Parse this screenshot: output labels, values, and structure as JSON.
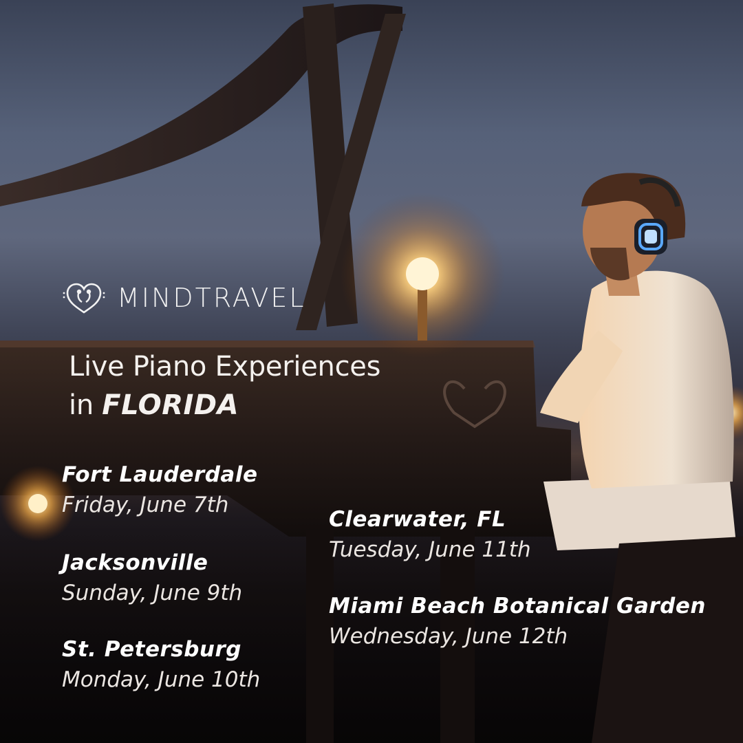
{
  "brand": {
    "name": "MINDTRAVEL",
    "logo_icon": "heart-music-icon"
  },
  "headline": {
    "line1": "Live Piano Experiences",
    "line2_prefix": "in",
    "state": "FLORIDA"
  },
  "events": [
    {
      "city": "Fort Lauderdale",
      "date": "Friday, June 7th"
    },
    {
      "city": "Jacksonville",
      "date": "Sunday, June 9th"
    },
    {
      "city": "St. Petersburg",
      "date": "Monday, June 10th"
    },
    {
      "city": "Clearwater, FL",
      "date": "Tuesday, June 11th"
    },
    {
      "city": "Miami Beach Botanical Garden",
      "date": "Wednesday, June 12th"
    }
  ],
  "colors": {
    "text": "#ffffff",
    "glow": "#ffb347",
    "headphone_led": "#5aa9ff"
  }
}
